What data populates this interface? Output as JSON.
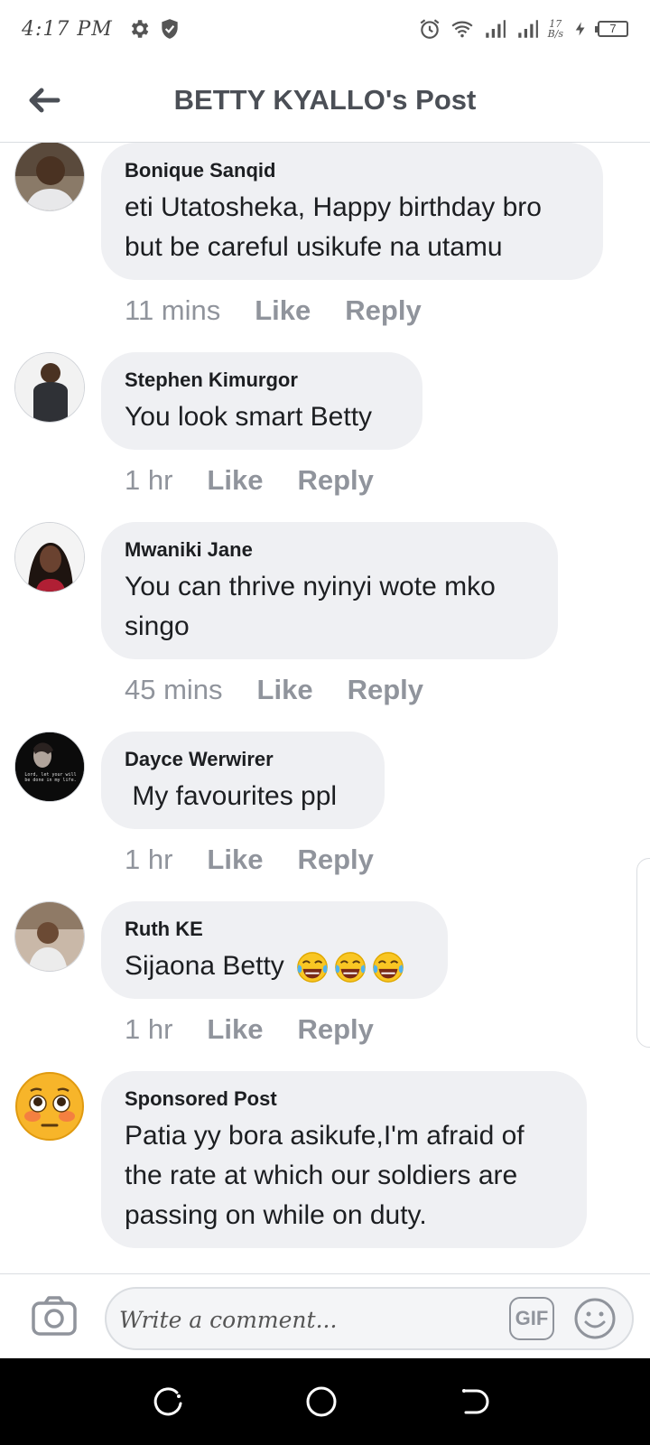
{
  "status_bar": {
    "time": "4:17 PM",
    "net_speed_top": "17",
    "net_speed_bottom": "B/s",
    "battery_level": "7",
    "icons": [
      "gear-icon",
      "shield-icon",
      "alarm-icon",
      "wifi-icon",
      "signal-icon",
      "signal-icon",
      "charging-icon",
      "battery-icon"
    ]
  },
  "header": {
    "title": "BETTY KYALLO's Post",
    "back_icon": "arrow-left-icon"
  },
  "comments": [
    {
      "author": "Bonique Sanqid",
      "text": "eti Utatosheka, Happy birthday bro but be careful usikufe na utamu",
      "time": "11 mins",
      "like": "Like",
      "reply": "Reply"
    },
    {
      "author": "Stephen Kimurgor",
      "text": "You look smart Betty",
      "time": "1 hr",
      "like": "Like",
      "reply": "Reply"
    },
    {
      "author": "Mwaniki Jane",
      "text": "You can thrive nyinyi wote mko singo",
      "time": "45 mins",
      "like": "Like",
      "reply": "Reply"
    },
    {
      "author": "Dayce Werwirer",
      "text": " My favourites ppl",
      "avatar_text": "Lord, let your will be done in my life.",
      "time": "1 hr",
      "like": "Like",
      "reply": "Reply"
    },
    {
      "author": "Ruth KE",
      "text": "Sijaona Betty",
      "emojis": [
        "laughing-tears-emoji",
        "laughing-tears-emoji",
        "laughing-tears-emoji"
      ],
      "time": "1 hr",
      "like": "Like",
      "reply": "Reply"
    },
    {
      "author": "Sponsored Post",
      "text": "Patia yy bora asikufe,I'm afraid of the rate at which our soldiers are passing on while on duty.",
      "avatar_emoji": "flushed-face-emoji"
    }
  ],
  "composer": {
    "placeholder": "Write a comment...",
    "gif_label": "GIF",
    "camera_icon": "camera-icon",
    "smiley_icon": "smiley-icon"
  },
  "nav_bar": {
    "icons": [
      "recents-icon",
      "home-icon",
      "back-icon"
    ]
  }
}
